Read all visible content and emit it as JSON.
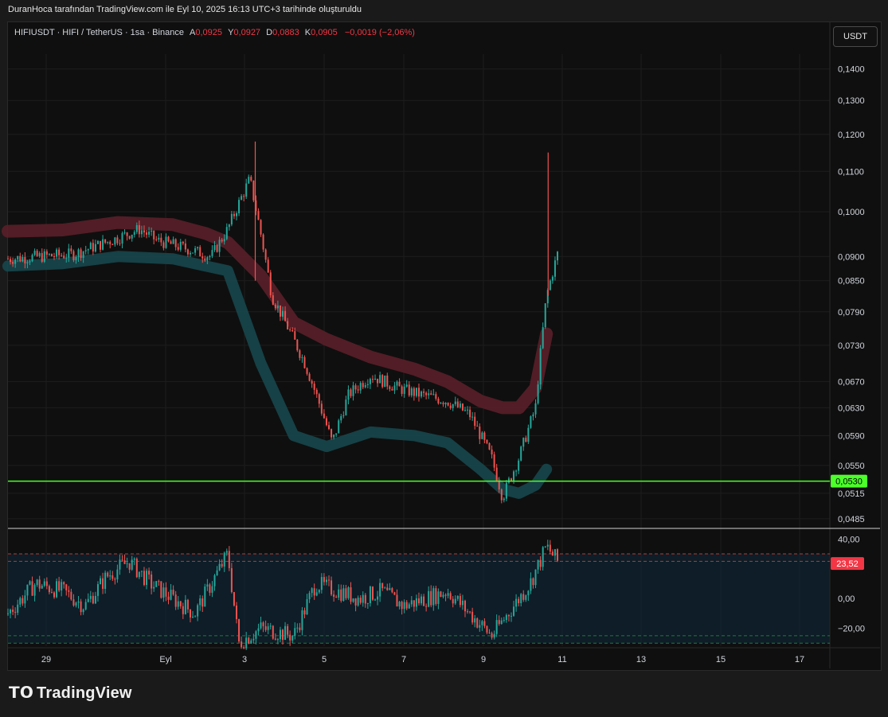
{
  "caption": "DuranHoca tarafından TradingView.com ile Eyl 10, 2025 16:13 UTC+3 tarihinde oluşturuldu",
  "symbol": {
    "title": "HIFIUSDT · HIFI / TetherUS · 1sa · Binance",
    "open_label": "A",
    "open": "0,0925",
    "high_label": "Y",
    "high": "0,0927",
    "low_label": "D",
    "low": "0,0883",
    "close_label": "K",
    "close": "0,0905",
    "change": "−0,0019 (−2,06%)"
  },
  "currency_button": "USDT",
  "brand": "TradingView",
  "colors": {
    "up": "#26a69a",
    "down": "#ef5350",
    "upper_band": "#5a1f29",
    "lower_band": "#17474c",
    "support_line": "#4cff2a",
    "rsi_badge": "#f23645",
    "price_badge": "#4cff2a"
  },
  "chart_data": {
    "type": "candlestick",
    "price_axis": {
      "ticks": [
        "0,1400",
        "0,1300",
        "0,1200",
        "0,1100",
        "0,1000",
        "0,0900",
        "0,0850",
        "0,0790",
        "0,0730",
        "0,0670",
        "0,0630",
        "0,0590",
        "0,0550",
        "0,0515",
        "0,0485"
      ],
      "scale": "log"
    },
    "time_axis": {
      "ticks": [
        "29",
        "Eyl",
        "3",
        "5",
        "7",
        "9",
        "11",
        "13",
        "15",
        "17"
      ]
    },
    "support_level": {
      "value": 0.053,
      "label": "0,0530"
    },
    "price_path": [
      [
        0,
        0.0895
      ],
      [
        12,
        0.0905
      ],
      [
        20,
        0.094
      ],
      [
        24,
        0.096
      ],
      [
        27,
        0.0935
      ],
      [
        33,
        0.0915
      ],
      [
        37,
        0.09
      ],
      [
        40,
        0.096
      ],
      [
        44,
        0.108
      ],
      [
        48,
        0.082
      ],
      [
        54,
        0.07
      ],
      [
        59,
        0.058
      ],
      [
        62,
        0.065
      ],
      [
        66,
        0.068
      ],
      [
        71,
        0.066
      ],
      [
        75,
        0.065
      ],
      [
        80,
        0.064
      ],
      [
        84,
        0.062
      ],
      [
        88,
        0.056
      ],
      [
        90,
        0.051
      ],
      [
        93,
        0.056
      ],
      [
        96,
        0.063
      ],
      [
        98,
        0.082
      ],
      [
        100,
        0.0905
      ]
    ],
    "upper_band": [
      [
        0,
        0.0955
      ],
      [
        10,
        0.0958
      ],
      [
        20,
        0.0975
      ],
      [
        30,
        0.097
      ],
      [
        36,
        0.095
      ],
      [
        40,
        0.093
      ],
      [
        46,
        0.086
      ],
      [
        52,
        0.077
      ],
      [
        58,
        0.074
      ],
      [
        66,
        0.071
      ],
      [
        74,
        0.069
      ],
      [
        80,
        0.067
      ],
      [
        86,
        0.064
      ],
      [
        90,
        0.063
      ],
      [
        93,
        0.063
      ],
      [
        96,
        0.066
      ],
      [
        98,
        0.075
      ]
    ],
    "lower_band": [
      [
        0,
        0.088
      ],
      [
        10,
        0.0885
      ],
      [
        20,
        0.09
      ],
      [
        30,
        0.0895
      ],
      [
        36,
        0.088
      ],
      [
        40,
        0.087
      ],
      [
        46,
        0.07
      ],
      [
        52,
        0.059
      ],
      [
        58,
        0.0575
      ],
      [
        66,
        0.0595
      ],
      [
        74,
        0.059
      ],
      [
        80,
        0.058
      ],
      [
        86,
        0.0545
      ],
      [
        90,
        0.052
      ],
      [
        93,
        0.0515
      ],
      [
        96,
        0.0525
      ],
      [
        98,
        0.0545
      ]
    ],
    "rsi": {
      "ticks": [
        "40,00",
        "0,00",
        "−20,00"
      ],
      "current": "23,52",
      "upper_band": 30,
      "lower_band": -30,
      "path": [
        [
          0,
          -10
        ],
        [
          5,
          10
        ],
        [
          10,
          5
        ],
        [
          14,
          -5
        ],
        [
          18,
          15
        ],
        [
          22,
          25
        ],
        [
          26,
          10
        ],
        [
          30,
          0
        ],
        [
          34,
          -10
        ],
        [
          37,
          10
        ],
        [
          40,
          30
        ],
        [
          42,
          -30
        ],
        [
          46,
          -20
        ],
        [
          52,
          -25
        ],
        [
          56,
          10
        ],
        [
          60,
          5
        ],
        [
          64,
          0
        ],
        [
          68,
          5
        ],
        [
          72,
          -5
        ],
        [
          76,
          0
        ],
        [
          80,
          5
        ],
        [
          84,
          -10
        ],
        [
          88,
          -25
        ],
        [
          92,
          -5
        ],
        [
          95,
          10
        ],
        [
          98,
          35
        ],
        [
          100,
          25
        ]
      ]
    }
  }
}
